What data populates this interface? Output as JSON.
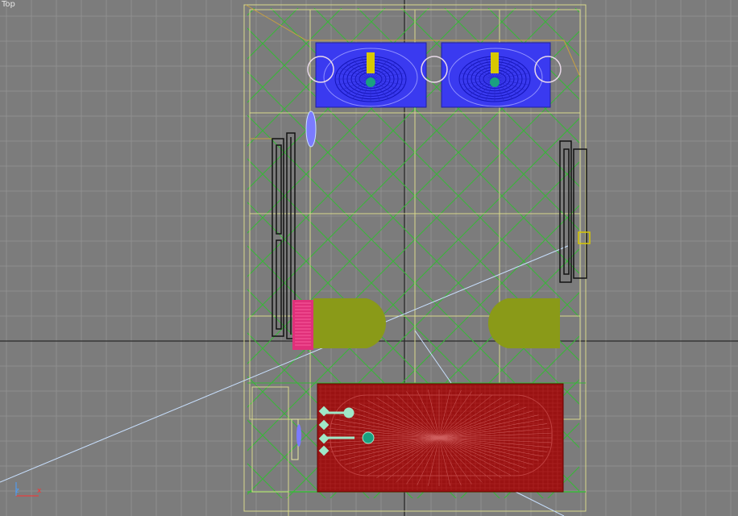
{
  "viewport": {
    "label": "Top",
    "axis_x": "x",
    "axis_y": "z"
  },
  "colors": {
    "background": "#7c7c7c",
    "grid_minor": "#8e8e8e",
    "grid_major": "#2a2a2a",
    "tile_lines": "#38b838",
    "walls": "#d9d98c",
    "sink": "#3a3af0",
    "basin": "#3434d6",
    "faucet": "#d8c800",
    "toilet": "#8a9a18",
    "tank": "#e0307a",
    "bathtub": "#9a1212",
    "fixtures": "#9fe8c8",
    "camera_line": "#c8e0ff",
    "doors": "#111111"
  },
  "scene": {
    "objects": [
      "sink",
      "sink",
      "door",
      "door",
      "toilet",
      "bidet",
      "bathtub",
      "mirror"
    ]
  }
}
